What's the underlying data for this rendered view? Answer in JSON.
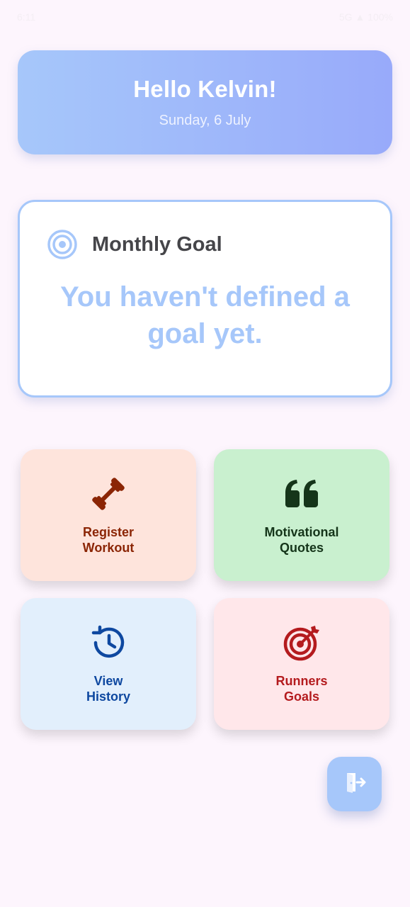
{
  "status_bar": {
    "time": "6:11",
    "indicators": "5G  ▲ 100%"
  },
  "header": {
    "greeting": "Hello Kelvin!",
    "date": "Sunday, 6 July"
  },
  "goal_card": {
    "icon": "target-icon",
    "title": "Monthly Goal",
    "message": "You haven't defined a goal yet."
  },
  "tiles": [
    {
      "label": "Register\nWorkout",
      "icon": "dumbbell-icon",
      "color": "#8b2505",
      "bg": "#fee4dc"
    },
    {
      "label": "Motivational\nQuotes",
      "icon": "quote-icon",
      "color": "#15351a",
      "bg": "#c9f0cf"
    },
    {
      "label": "View\nHistory",
      "icon": "history-icon",
      "color": "#0e48a0",
      "bg": "#e2effc"
    },
    {
      "label": "Runners\nGoals",
      "icon": "bullseye-icon",
      "color": "#b41b1e",
      "bg": "#ffe7ea"
    }
  ],
  "fab": {
    "icon": "logout-icon"
  },
  "colors": {
    "accent": "#a6c7fa",
    "background": "#fdf5fd"
  }
}
